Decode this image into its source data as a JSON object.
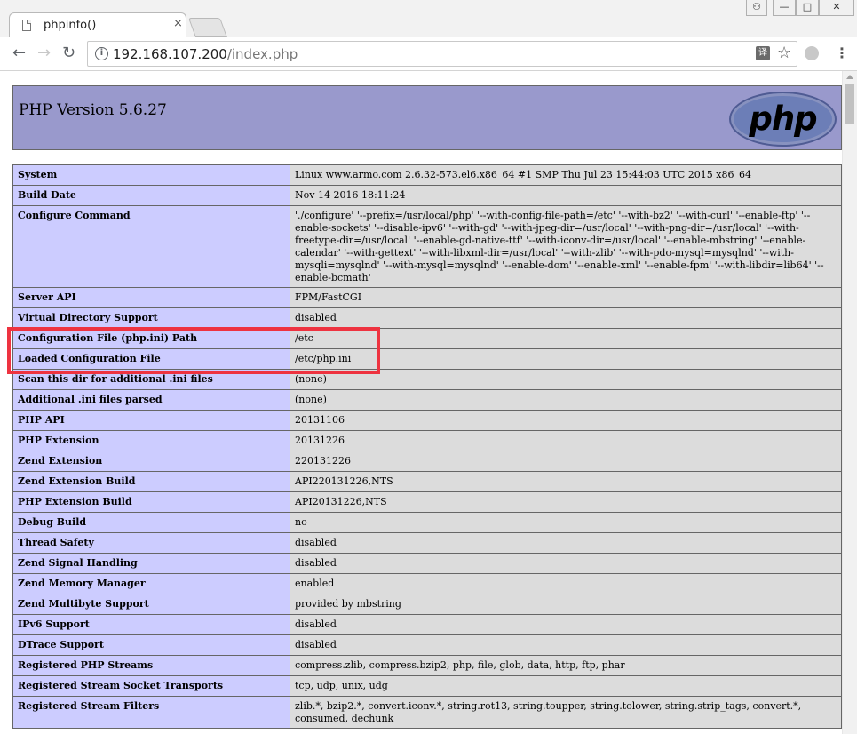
{
  "browser": {
    "tab_title": "phpinfo()",
    "tab_close": "×",
    "url_host": "192.168.107.200",
    "url_path": "/index.php",
    "translate_glyph": "译",
    "star_glyph": "☆",
    "menu_glyph": "⋮",
    "back_glyph": "←",
    "forward_glyph": "→",
    "reload_glyph": "↻",
    "win_min": "—",
    "win_max": "□",
    "win_close": "✕",
    "win_user": "⚇"
  },
  "page": {
    "header_title": "PHP Version 5.6.27",
    "logo_text": "php",
    "rows": [
      {
        "key": "System",
        "value": "Linux www.armo.com 2.6.32-573.el6.x86_64 #1 SMP Thu Jul 23 15:44:03 UTC 2015 x86_64"
      },
      {
        "key": "Build Date",
        "value": "Nov 14 2016 18:11:24"
      },
      {
        "key": "Configure Command",
        "value": "'./configure' '--prefix=/usr/local/php' '--with-config-file-path=/etc' '--with-bz2' '--with-curl' '--enable-ftp' '--enable-sockets' '--disable-ipv6' '--with-gd' '--with-jpeg-dir=/usr/local' '--with-png-dir=/usr/local' '--with-freetype-dir=/usr/local' '--enable-gd-native-ttf' '--with-iconv-dir=/usr/local' '--enable-mbstring' '--enable-calendar' '--with-gettext' '--with-libxml-dir=/usr/local' '--with-zlib' '--with-pdo-mysql=mysqlnd' '--with-mysqli=mysqlnd' '--with-mysql=mysqlnd' '--enable-dom' '--enable-xml' '--enable-fpm' '--with-libdir=lib64' '--enable-bcmath'"
      },
      {
        "key": "Server API",
        "value": "FPM/FastCGI"
      },
      {
        "key": "Virtual Directory Support",
        "value": "disabled"
      },
      {
        "key": "Configuration File (php.ini) Path",
        "value": "/etc"
      },
      {
        "key": "Loaded Configuration File",
        "value": "/etc/php.ini"
      },
      {
        "key": "Scan this dir for additional .ini files",
        "value": "(none)"
      },
      {
        "key": "Additional .ini files parsed",
        "value": "(none)"
      },
      {
        "key": "PHP API",
        "value": "20131106"
      },
      {
        "key": "PHP Extension",
        "value": "20131226"
      },
      {
        "key": "Zend Extension",
        "value": "220131226"
      },
      {
        "key": "Zend Extension Build",
        "value": "API220131226,NTS"
      },
      {
        "key": "PHP Extension Build",
        "value": "API20131226,NTS"
      },
      {
        "key": "Debug Build",
        "value": "no"
      },
      {
        "key": "Thread Safety",
        "value": "disabled"
      },
      {
        "key": "Zend Signal Handling",
        "value": "disabled"
      },
      {
        "key": "Zend Memory Manager",
        "value": "enabled"
      },
      {
        "key": "Zend Multibyte Support",
        "value": "provided by mbstring"
      },
      {
        "key": "IPv6 Support",
        "value": "disabled"
      },
      {
        "key": "DTrace Support",
        "value": "disabled"
      },
      {
        "key": "Registered PHP Streams",
        "value": "compress.zlib, compress.bzip2, php, file, glob, data, http, ftp, phar"
      },
      {
        "key": "Registered Stream Socket Transports",
        "value": "tcp, udp, unix, udg"
      },
      {
        "key": "Registered Stream Filters",
        "value": "zlib.*, bzip2.*, convert.iconv.*, string.rot13, string.toupper, string.tolower, string.strip_tags, convert.*, consumed, dechunk"
      }
    ]
  },
  "colors": {
    "header_bg": "#9999cc",
    "key_bg": "#ccccff",
    "value_bg": "#dcdcdc",
    "highlight": "#ee3340"
  }
}
